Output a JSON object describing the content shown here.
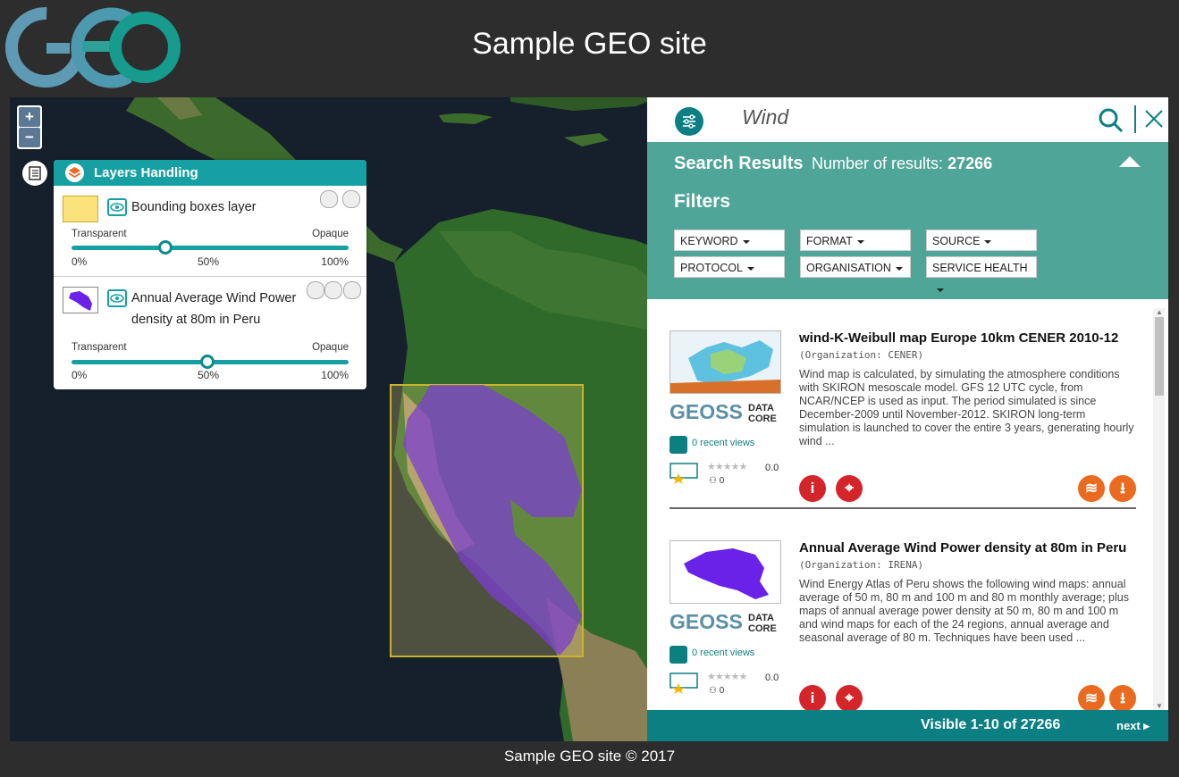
{
  "site": {
    "title": "Sample GEO site",
    "footer": "Sample GEO site © 2017",
    "logo_text": "GEO"
  },
  "map": {
    "zoom_in": "+",
    "zoom_out": "−"
  },
  "layers_panel": {
    "title": "Layers Handling",
    "layers": [
      {
        "name": "Bounding boxes layer",
        "left_label": "Transparent",
        "right_label": "Opaque",
        "ticks": [
          "0%",
          "50%",
          "100%"
        ],
        "opacity_percent": 34
      },
      {
        "name_line1": "Annual Average Wind Power",
        "name_line2": "density at 80m in Peru",
        "left_label": "Transparent",
        "right_label": "Opaque",
        "ticks": [
          "0%",
          "50%",
          "100%"
        ],
        "opacity_percent": 49
      }
    ]
  },
  "search": {
    "query": "Wind",
    "results_title": "Search Results",
    "count_label": "Number of results:",
    "count": "27266",
    "filters_label": "Filters",
    "filters": [
      "KEYWORD",
      "FORMAT",
      "SOURCE",
      "PROTOCOL",
      "ORGANISATION",
      "SERVICE HEALTH"
    ]
  },
  "results": [
    {
      "title": "wind-K-Weibull map Europe 10km CENER 2010-12",
      "org": "(Organization: CENER)",
      "description": "Wind map is calculated, by simulating the atmosphere conditions with SKIRON mesoscale model. GFS 12 UTC cycle, from NCAR/NCEP is used as input. The period simulated is since December-2009 until November-2012. SKIRON long-term simulation is launched to cover the entire 3 years, generating hourly wind ...",
      "views": "0 recent views",
      "stars": "★★★★★",
      "rating": "0.0",
      "users": "0"
    },
    {
      "title": "Annual Average Wind Power density at 80m in Peru",
      "org": "(Organization: IRENA)",
      "description": "Wind Energy Atlas of Peru shows the following wind maps: annual average of 50 m, 80 m and 100 m and 80 m monthly average; plus maps of annual average power density at 50 m, 80 m and 100 m and wind maps for each of the 24 regions, annual average and seasonal average of 80 m. Techniques have been used ...",
      "views": "0 recent views",
      "stars": "★★★★★",
      "rating": "0.0",
      "users": "0"
    }
  ],
  "geoss": {
    "letters": "GEOSS",
    "data": "DATA",
    "core": "CORE"
  },
  "pager": {
    "visible": "Visible 1-10 of 27266",
    "next": "next"
  },
  "colors": {
    "teal": "#0c7f82",
    "teal_light": "#4fa597",
    "red": "#d4252b",
    "orange": "#ea6a1f",
    "bbox_yellow": "#fbe27b",
    "peru_purple": "#7b3fd0"
  },
  "icons": [
    "plus-icon",
    "minus-icon",
    "layers-icon",
    "eye-icon",
    "gear-icon",
    "lock-icon",
    "pin-icon",
    "close-icon",
    "search-icon",
    "filter-icon",
    "info-icon",
    "map-pin-icon",
    "layers-add-icon",
    "download-icon",
    "chevron-up-icon",
    "chevron-right-icon"
  ]
}
